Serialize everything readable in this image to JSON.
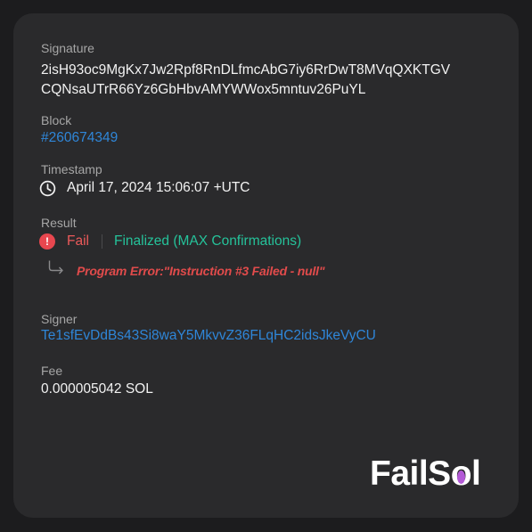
{
  "signature": {
    "label": "Signature",
    "line1": "2isH93oc9MgKx7Jw2Rpf8RnDLfmcAbG7iy6RrDwT8MVqQXKTGV",
    "line2": "CQNsaUTrR66Yz6GbHbvAMYWWox5mntuv26PuYL"
  },
  "block": {
    "label": "Block",
    "value": "#260674349"
  },
  "timestamp": {
    "label": "Timestamp",
    "icon": "clock-icon",
    "value": "April 17, 2024 15:06:07 +UTC"
  },
  "result": {
    "label": "Result",
    "status_icon": "exclamation-icon",
    "status": "Fail",
    "confirmation": "Finalized (MAX Confirmations)",
    "error_icon": "return-arrow-icon",
    "error_message": "Program Error:\"Instruction #3 Failed - null\""
  },
  "signer": {
    "label": "Signer",
    "value": "Te1sfEvDdBs43Si8waY5MkvvZ36FLqHC2idsJkeVyCU"
  },
  "fee": {
    "label": "Fee",
    "value": "0.000005042 SOL"
  },
  "brand": {
    "prefix": "FailS",
    "o": "o",
    "suffix": "l"
  },
  "colors": {
    "background": "#1c1c1e",
    "card": "#2a2a2c",
    "link": "#2f86d8",
    "fail": "#ec5a5a",
    "finalized": "#25c29a",
    "brand_accent": "#b35ad6"
  }
}
